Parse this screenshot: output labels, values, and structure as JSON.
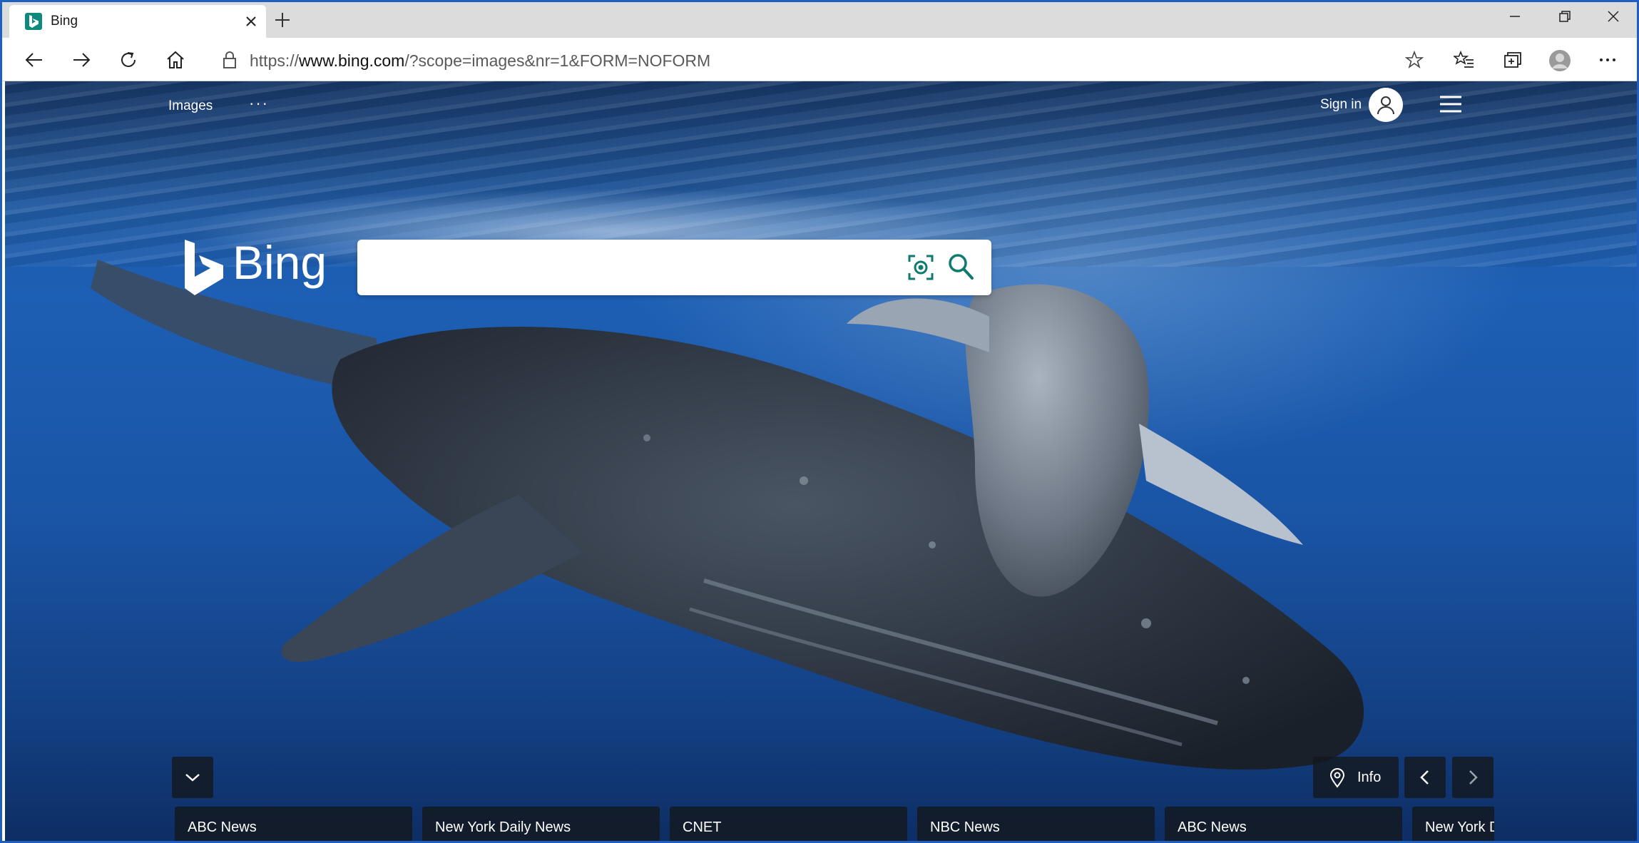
{
  "browser": {
    "tab": {
      "title": "Bing"
    },
    "url": {
      "prefix": "https://",
      "host": "www.bing.com",
      "path": "/?scope=images&nr=1&FORM=NOFORM"
    }
  },
  "page": {
    "nav": {
      "images_label": "Images",
      "more_label": "···"
    },
    "account": {
      "signin_label": "Sign in"
    },
    "logo_text": "Bing",
    "search": {
      "placeholder": ""
    },
    "info_label": "Info",
    "news": [
      {
        "label": "ABC News"
      },
      {
        "label": "New York Daily News"
      },
      {
        "label": "CNET"
      },
      {
        "label": "NBC News"
      },
      {
        "label": "ABC News"
      },
      {
        "label": "New York D"
      }
    ]
  },
  "colors": {
    "accent": "#0e8a7d",
    "window_border": "#1f5fbf"
  }
}
